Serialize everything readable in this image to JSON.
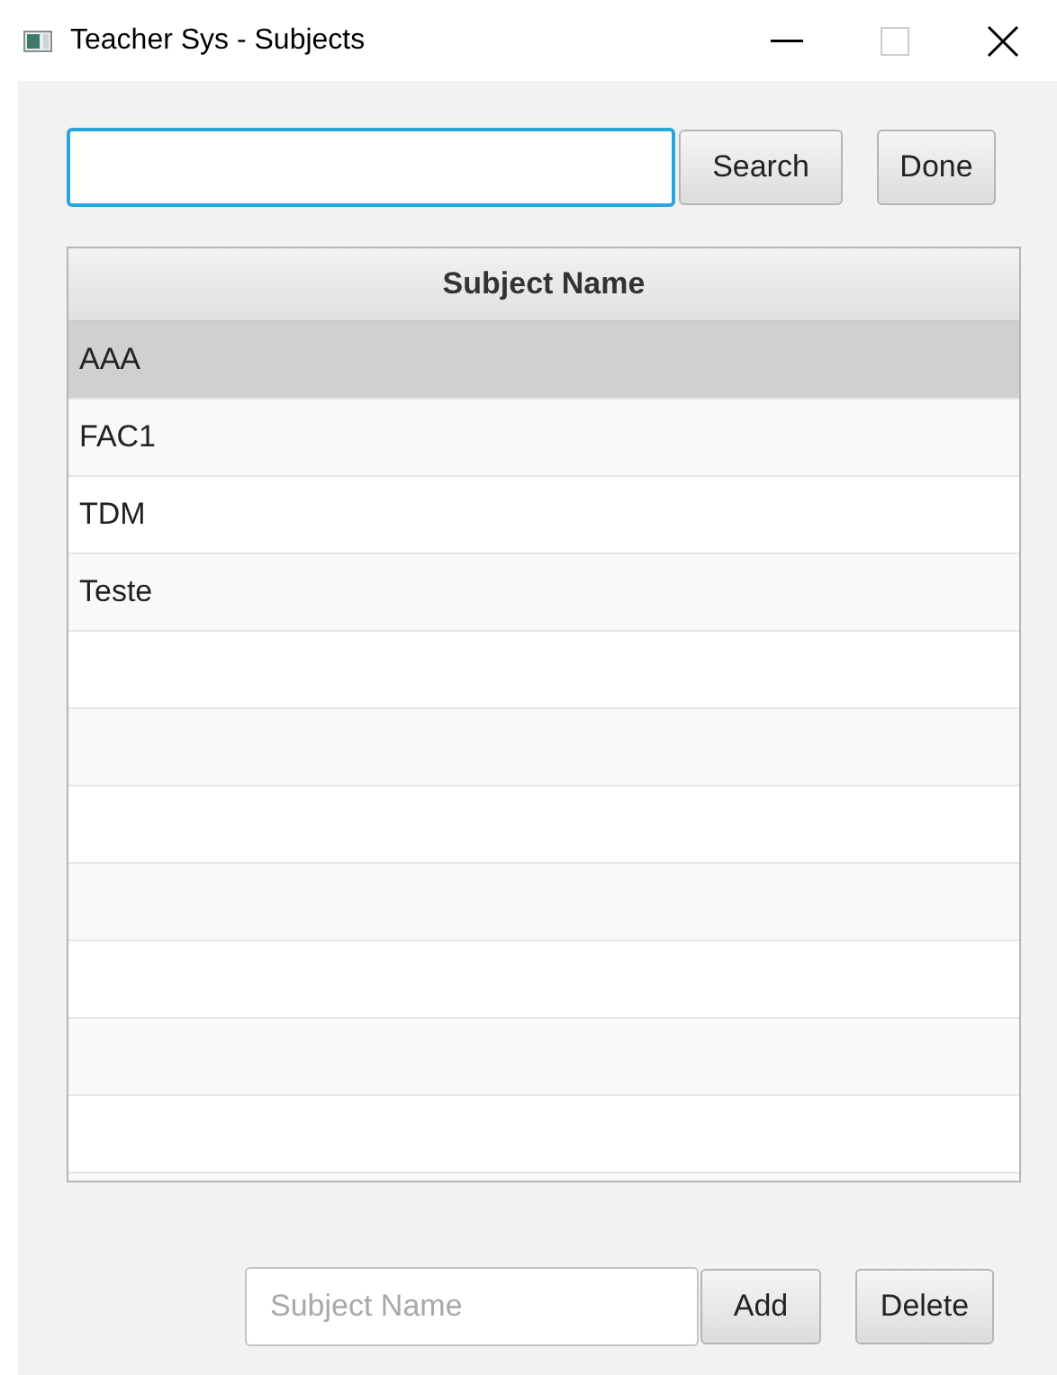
{
  "window": {
    "title": "Teacher Sys - Subjects"
  },
  "search": {
    "focused": true,
    "button": "Search"
  },
  "done_button": "Done",
  "table": {
    "columns": [
      "Subject Name"
    ],
    "rows": [
      {
        "name": "AAA",
        "selected": true
      },
      {
        "name": "FAC1",
        "selected": false
      },
      {
        "name": "TDM",
        "selected": false
      },
      {
        "name": "Teste",
        "selected": false
      }
    ]
  },
  "add_field": {
    "placeholder": "Subject Name"
  },
  "add_button": "Add",
  "delete_button": "Delete"
}
